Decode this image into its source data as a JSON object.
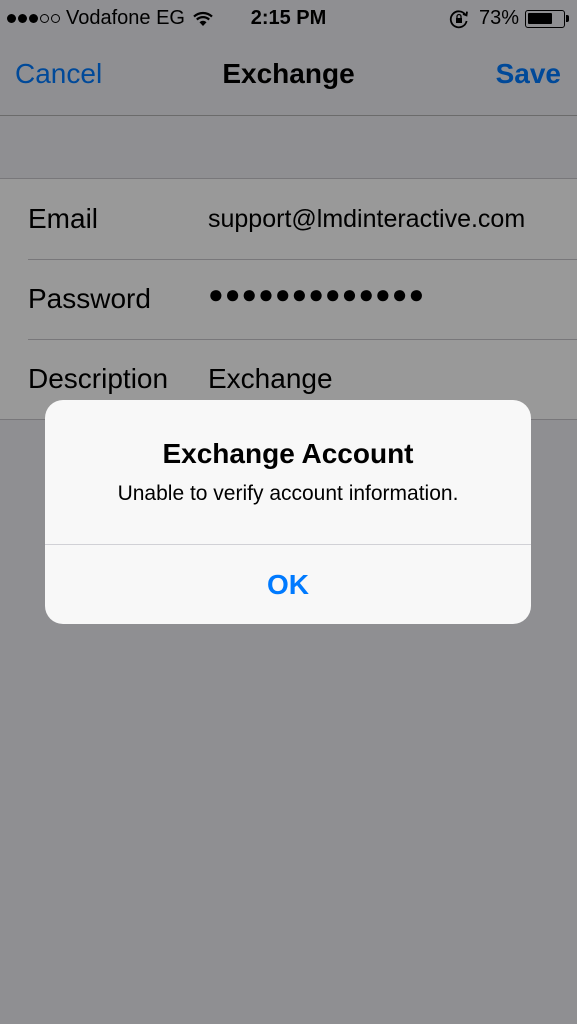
{
  "status_bar": {
    "carrier": "Vodafone EG",
    "time": "2:15 PM",
    "battery_percent": "73%",
    "battery_level": 0.73,
    "signal_bars_filled": 3,
    "signal_bars_total": 5
  },
  "nav": {
    "cancel_label": "Cancel",
    "title": "Exchange",
    "save_label": "Save"
  },
  "form": {
    "email_label": "Email",
    "email_value": "support@lmdinteractive.com",
    "password_label": "Password",
    "password_value": "●●●●●●●●●●●●●",
    "description_label": "Description",
    "description_value": "Exchange"
  },
  "alert": {
    "title": "Exchange Account",
    "message": "Unable to verify account information.",
    "ok_label": "OK"
  },
  "colors": {
    "accent": "#007aff",
    "background": "#efeff4"
  }
}
